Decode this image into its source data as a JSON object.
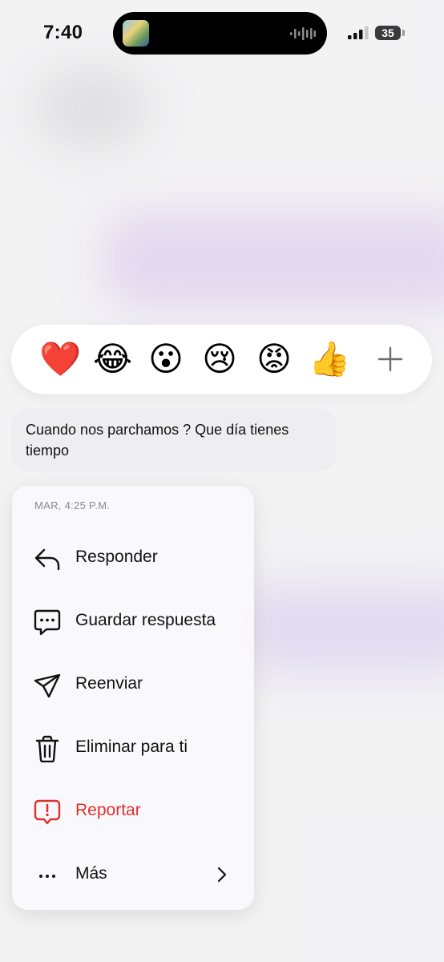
{
  "status_bar": {
    "time": "7:40",
    "battery": "35"
  },
  "reactions": {
    "emojis": [
      {
        "name": "heart",
        "glyph": "❤️"
      },
      {
        "name": "laughing-tears",
        "glyph": "😂"
      },
      {
        "name": "surprised",
        "glyph": "😮"
      },
      {
        "name": "crying",
        "glyph": "😢"
      },
      {
        "name": "angry",
        "glyph": "😡"
      },
      {
        "name": "thumbs-up",
        "glyph": "👍"
      }
    ],
    "more_icon": "plus-icon"
  },
  "message": {
    "text": "Cuando nos parchamos ? Que día tienes tiempo"
  },
  "menu": {
    "timestamp": "MAR, 4:25 P.M.",
    "items": [
      {
        "label": "Responder",
        "icon": "reply-icon"
      },
      {
        "label": "Guardar respuesta",
        "icon": "saved-reply-icon"
      },
      {
        "label": "Reenviar",
        "icon": "forward-icon"
      },
      {
        "label": "Eliminar para ti",
        "icon": "trash-icon"
      },
      {
        "label": "Reportar",
        "icon": "report-icon",
        "color": "#e0302b"
      },
      {
        "label": "Más",
        "icon": "more-icon",
        "trailing_icon": "chevron-right-icon"
      }
    ]
  }
}
